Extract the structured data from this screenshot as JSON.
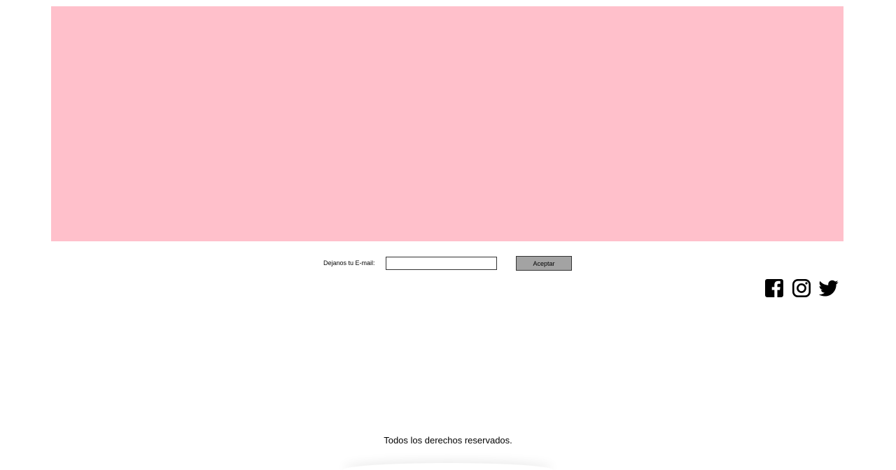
{
  "banner": {
    "color": "#ffc0cb"
  },
  "newsletter": {
    "label": "Dejanos tu E-mail:",
    "email_value": "",
    "email_placeholder": "",
    "submit_label": "Aceptar",
    "button_color": "#a3a3a3"
  },
  "social": {
    "icons": [
      "facebook-icon",
      "instagram-icon",
      "twitter-icon"
    ]
  },
  "footer": {
    "copyright": "Todos los derechos reservados."
  }
}
